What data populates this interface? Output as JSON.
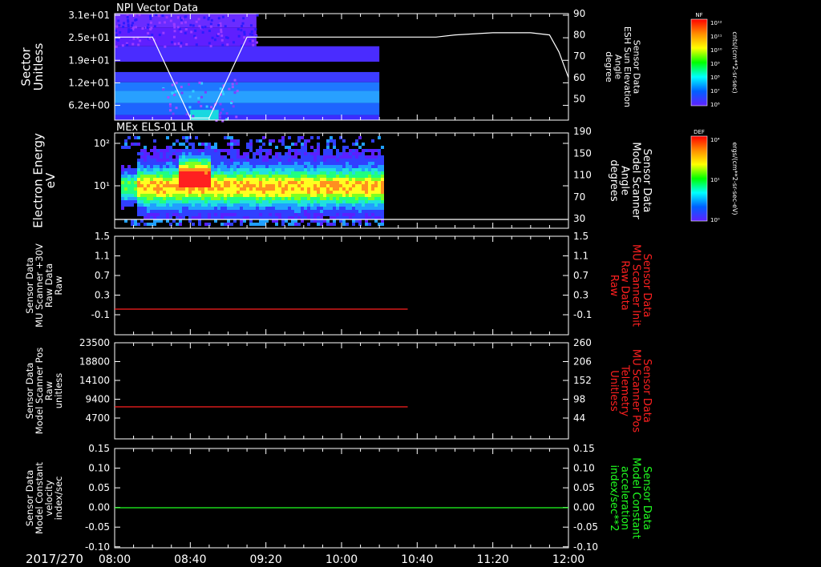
{
  "colors": {
    "background": "#000000",
    "axis": "#ffffff",
    "red_trace": "#ff2020",
    "green_trace": "#20ff20",
    "red_label": "#ff2020",
    "green_label": "#20ff20"
  },
  "colorbars": [
    {
      "id": "nf",
      "tag": "NF",
      "unit": "cnts/(cm**2-sr-sec)",
      "tick_labels": [
        "10¹²",
        "10¹¹",
        "10¹⁰",
        "10⁹",
        "10⁸",
        "10⁷",
        "10⁶"
      ],
      "gradient": [
        "#ff0000",
        "#ff8c00",
        "#ffff00",
        "#00ff00",
        "#00ffff",
        "#0060ff",
        "#6020ff"
      ]
    },
    {
      "id": "def",
      "tag": "DEF",
      "unit": "ergs/(cm**2-sr-sec-eV)",
      "tick_labels": [
        "10⁴",
        "10¹",
        "10⁰"
      ],
      "gradient": [
        "#ff0000",
        "#ff8c00",
        "#ffff00",
        "#00ff00",
        "#00ffff",
        "#0060ff",
        "#6020ff"
      ]
    }
  ],
  "chart_data": [
    {
      "id": "npi",
      "type": "heatmap",
      "title": "NPI Vector Data",
      "ylabel": [
        "Sector",
        "Unitless"
      ],
      "yticks": [
        "3.1e+01",
        "2.5e+01",
        "1.9e+01",
        "1.2e+01",
        "6.2e+00"
      ],
      "ylim": [
        0,
        31
      ],
      "right_ylabel": [
        "Sensor Data",
        "ESH Sun Elevation",
        "Angle",
        "degree"
      ],
      "right_yticks": [
        90,
        80,
        70,
        60,
        50
      ],
      "right_ylim": [
        40,
        90
      ],
      "data_end_time": "10:20",
      "heatmap_bands": [
        {
          "y0": 27.0,
          "y1": 31.0,
          "x0": "08:00",
          "x1": "09:15",
          "color": "#6a2cff"
        },
        {
          "y0": 21.5,
          "y1": 27.0,
          "x0": "08:00",
          "x1": "09:15",
          "color": "#5f1fff"
        },
        {
          "y0": 17.0,
          "y1": 21.5,
          "x0": "08:00",
          "x1": "10:20",
          "color": "#4a2cff"
        },
        {
          "y0": 11.0,
          "y1": 14.0,
          "x0": "08:00",
          "x1": "10:20",
          "color": "#3c3cff"
        },
        {
          "y0": 8.5,
          "y1": 11.0,
          "x0": "08:00",
          "x1": "10:20",
          "color": "#1e78ff"
        },
        {
          "y0": 5.0,
          "y1": 8.5,
          "x0": "08:00",
          "x1": "10:20",
          "color": "#28a0ff"
        },
        {
          "y0": 1.5,
          "y1": 5.0,
          "x0": "08:00",
          "x1": "10:20",
          "color": "#1e64ff"
        },
        {
          "y0": 0.0,
          "y1": 1.5,
          "x0": "08:00",
          "x1": "10:20",
          "color": "#3c2cff"
        },
        {
          "y0": 0.0,
          "y1": 3.0,
          "x0": "08:40",
          "x1": "08:55",
          "color": "#18d8e0"
        }
      ],
      "series": [
        {
          "name": "ESH Sun Elevation Angle",
          "axis": "right",
          "color": "#ffffff",
          "x": [
            "08:00",
            "08:10",
            "08:20",
            "08:30",
            "08:40",
            "08:50",
            "09:00",
            "09:10",
            "09:20",
            "09:40",
            "10:00",
            "10:20",
            "10:40",
            "10:50",
            "11:00",
            "11:20",
            "11:40",
            "11:50",
            "11:55",
            "12:00"
          ],
          "y": [
            79,
            79,
            79,
            60,
            41,
            41,
            60,
            79,
            79,
            79,
            79,
            79,
            79,
            79,
            80,
            81,
            81,
            80,
            72,
            60
          ]
        }
      ]
    },
    {
      "id": "els",
      "type": "heatmap",
      "title": "MEx ELS-01 LR",
      "ylabel": [
        "Electron Energy",
        "eV"
      ],
      "yticks": [
        "10²",
        "10¹"
      ],
      "ylim_log": [
        0.3,
        2.2
      ],
      "right_ylabel": [
        "Sensor Data",
        "Model Scanner",
        "Angle",
        "degrees"
      ],
      "right_yticks": [
        190,
        150,
        110,
        70,
        30
      ],
      "right_ylim": [
        0,
        190
      ],
      "data_end_time": "10:22",
      "series": [
        {
          "name": "Model Scanner Angle",
          "axis": "right",
          "color": "#ffffff",
          "x": [
            "08:00",
            "12:00"
          ],
          "y": [
            10,
            10
          ]
        }
      ]
    },
    {
      "id": "mu30",
      "type": "line",
      "ylabel": [
        "Sensor Data",
        "MU Scanner +30V",
        "Raw Data",
        "Raw"
      ],
      "yticks": [
        "1.5",
        "1.1",
        "0.7",
        "0.3",
        "-0.1"
      ],
      "ylim": [
        -0.3,
        1.5
      ],
      "right_ylabel": [
        "Sensor Data",
        "MU Scanner Init",
        "Raw Data",
        "Raw"
      ],
      "right_yticks": [
        "1.5",
        "1.1",
        "0.7",
        "0.3",
        "-0.1"
      ],
      "right_ylim": [
        -0.3,
        1.5
      ],
      "series": [
        {
          "name": "MU Scanner Init",
          "axis": "right",
          "color": "#ff2020",
          "x": [
            "08:00",
            "10:35"
          ],
          "y": [
            0.0,
            0.0
          ]
        }
      ]
    },
    {
      "id": "pos",
      "type": "line",
      "ylabel": [
        "Sensor Data",
        "Model Scanner Pos",
        "Raw",
        "unitless"
      ],
      "yticks": [
        "23500",
        "18800",
        "14100",
        "9400",
        "4700"
      ],
      "ylim": [
        0,
        23500
      ],
      "right_ylabel": [
        "Sensor Data",
        "MU Scanner Pos",
        "Telemetry",
        "Unitless"
      ],
      "right_yticks": [
        "260",
        "206",
        "152",
        "98",
        "44"
      ],
      "right_ylim": [
        0,
        260
      ],
      "series": [
        {
          "name": "MU Scanner Pos Telemetry",
          "axis": "right",
          "color": "#ff2020",
          "x": [
            "08:00",
            "10:35"
          ],
          "y": [
            93,
            93
          ]
        }
      ]
    },
    {
      "id": "vel",
      "type": "line",
      "ylabel": [
        "Sensor Data",
        "Model Constant",
        "velocity",
        "index/sec"
      ],
      "yticks": [
        "0.15",
        "0.10",
        "0.05",
        "0.00",
        "-0.05",
        "-0.10"
      ],
      "ylim": [
        -0.1,
        0.15
      ],
      "right_ylabel": [
        "Sensor Data",
        "Model Constant",
        "acceleration",
        "index/sec**2"
      ],
      "right_yticks": [
        "0.15",
        "0.10",
        "0.05",
        "0.00",
        "-0.05",
        "-0.10"
      ],
      "right_ylim": [
        -0.1,
        0.15
      ],
      "series": [
        {
          "name": "Model Constant acceleration",
          "axis": "right",
          "color": "#20ff20",
          "x": [
            "08:00",
            "12:00"
          ],
          "y": [
            0.0,
            0.0
          ]
        }
      ]
    }
  ],
  "time_axis": {
    "date_label": "2017/270",
    "tick_labels": [
      "08:00",
      "08:40",
      "09:20",
      "10:00",
      "10:40",
      "11:20",
      "12:00"
    ],
    "range": [
      "08:00",
      "12:00"
    ]
  }
}
